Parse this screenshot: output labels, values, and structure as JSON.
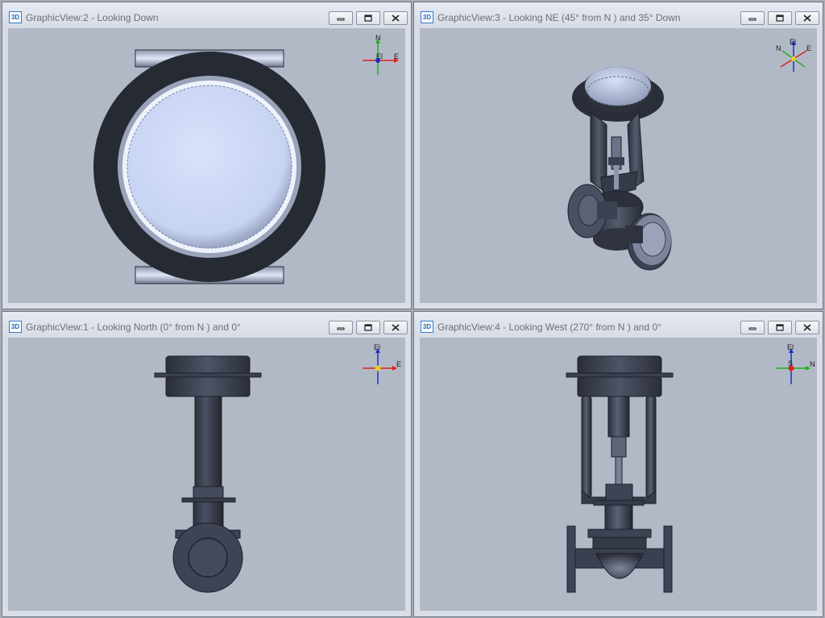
{
  "windows": [
    {
      "id": "view2",
      "title": "GraphicView:2 - Looking Down",
      "app_icon": "3D",
      "triad": {
        "labels": [
          "N",
          "El",
          "E"
        ]
      }
    },
    {
      "id": "view3",
      "title": "GraphicView:3 - Looking NE (45° from N ) and 35° Down",
      "app_icon": "3D",
      "triad": {
        "labels": [
          "El",
          "N",
          "E"
        ]
      }
    },
    {
      "id": "view1",
      "title": "GraphicView:1 - Looking North (0° from N ) and 0°",
      "app_icon": "3D",
      "triad": {
        "labels": [
          "El",
          "E"
        ]
      }
    },
    {
      "id": "view4",
      "title": "GraphicView:4 - Looking West (270° from N ) and 0°",
      "app_icon": "3D",
      "triad": {
        "labels": [
          "El",
          "S",
          "N"
        ]
      }
    }
  ],
  "window_buttons": {
    "minimize": "minimize-icon",
    "maximize": "maximize-icon",
    "close": "close-icon"
  },
  "colors": {
    "viewport_bg": "#b2b9c6",
    "model_dark": "#2e323c",
    "model_highlight": "#c9d6f4",
    "triad_x": "#e02020",
    "triad_y": "#20b020",
    "triad_z": "#1a2fd0"
  }
}
